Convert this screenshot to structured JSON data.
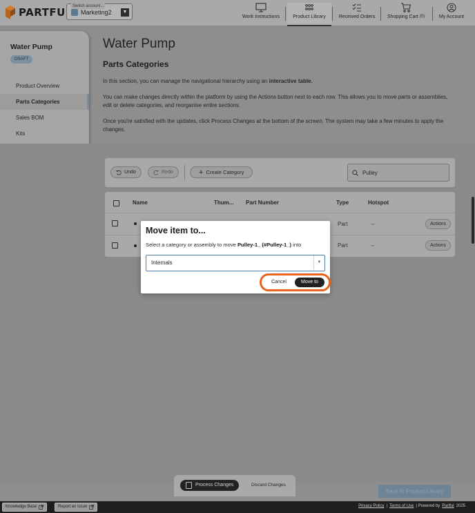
{
  "brand": {
    "name": "PARTFUL"
  },
  "account_switch": {
    "caption": "Switch account...",
    "value": "Marketing2"
  },
  "nav": [
    {
      "label": "Work Instructions",
      "icon": "monitor-icon"
    },
    {
      "label": "Product Library",
      "icon": "grid-icon"
    },
    {
      "label": "Received Orders",
      "icon": "checklist-icon"
    },
    {
      "label": "Shopping Cart",
      "badge": "(0)",
      "icon": "cart-icon"
    },
    {
      "label": "My Account",
      "icon": "user-icon"
    }
  ],
  "sidebar": {
    "title": "Water Pump",
    "badge": "DRAFT",
    "items": [
      {
        "label": "Product Overview"
      },
      {
        "label": "Parts Categories"
      },
      {
        "label": "Sales BOM"
      },
      {
        "label": "Kits"
      }
    ]
  },
  "page": {
    "title": "Water Pump",
    "section_title": "Parts Categories",
    "p1_a": "In this section, you can manage the navigational hierarchy using an ",
    "p1_b": "interactive table.",
    "p2": "You can make changes directly within the platform by using the Actions button next to each row. This allows you to move parts or assemblies, edit or delete categories, and reorganise entire sections.",
    "p3": "Once you're satisfied with the updates, click Process Changes at the bottom of the screen. The system may take a few minutes to apply the changes."
  },
  "toolbar": {
    "undo": "Undo",
    "redo": "Redo",
    "create": "Create Category",
    "search_value": "Pulley"
  },
  "table": {
    "headers": {
      "name": "Name",
      "thumb": "Thum...",
      "part": "Part Number",
      "type": "Type",
      "hotspot": "Hotspot"
    },
    "rows": [
      {
        "type": "Part",
        "hotspot": "--",
        "action": "Actions"
      },
      {
        "type": "Part",
        "hotspot": "--",
        "action": "Actions"
      }
    ]
  },
  "modal": {
    "title": "Move item to...",
    "desc_a": "Select a category or assembly to move ",
    "desc_item": "Pulley-1_ (#Pulley-1_)",
    "desc_b": " into",
    "select_value": "Internals",
    "cancel": "Cancel",
    "confirm": "Move to",
    "highlight_color": "#e8631c"
  },
  "bottom": {
    "process": "Process Changes",
    "discard": "Discard Changes",
    "back": "Back to Product Library"
  },
  "footer": {
    "kb": "Knowledge Base",
    "report": "Report an Issue",
    "privacy": "Privacy Policy",
    "sep": "|",
    "terms": "Terms of Use",
    "powered": "| Powered by",
    "powered_brand": "Partful",
    "year": "2025"
  }
}
